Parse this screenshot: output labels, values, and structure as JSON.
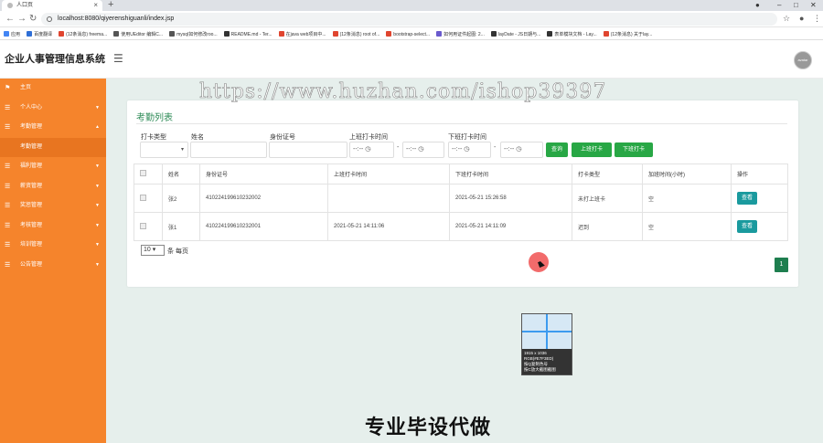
{
  "browser": {
    "tab_title": "人口页",
    "tab_close": "×",
    "new_tab": "+",
    "url": "localhost:8080/qiyerenshiguanli/index.jsp",
    "bookmarks": [
      "应用",
      "百度翻译",
      "(12条消息) freema...",
      "使用UEditor 编辑C...",
      "mysql如何修改roo...",
      "README.md - Ter...",
      "在java web项目中...",
      "(12条消息) root of...",
      "bootstrap-select...",
      "如何用证件起图: 2...",
      "layDate - JS日期与...",
      "表单模块文档 - Lay...",
      "(12条消息) 关于lay..."
    ]
  },
  "header": {
    "brand": "企业人事管理信息系统",
    "avatar_text": "avatar"
  },
  "sidebar": {
    "items": [
      {
        "label": "主页"
      },
      {
        "label": "个人中心"
      },
      {
        "label": "考勤管理"
      },
      {
        "label": "考勤管理"
      },
      {
        "label": "福利管理"
      },
      {
        "label": "薪资管理"
      },
      {
        "label": "奖惩管理"
      },
      {
        "label": "考核管理"
      },
      {
        "label": "培训管理"
      },
      {
        "label": "公告管理"
      }
    ]
  },
  "watermark": "https://www.huzhan.com/ishop39397",
  "main": {
    "title": "考勤列表",
    "filters": {
      "type_label": "打卡类型",
      "name_label": "姓名",
      "id_label": "身份证号",
      "on_label": "上班打卡时间",
      "off_label": "下班打卡时间",
      "time_placeholder": "--:-- ◷",
      "dash": "-"
    },
    "buttons": {
      "search": "查询",
      "clock_in": "上班打卡",
      "clock_out": "下班打卡"
    },
    "table": {
      "headers": [
        "姓名",
        "身份证号",
        "上班打卡时间",
        "下班打卡时间",
        "打卡类型",
        "加班时间(小时)",
        "操作"
      ],
      "rows": [
        {
          "name": "张2",
          "id": "410224199610232002",
          "on": "",
          "off": "2021-05-21 15:26:58",
          "type": "未打上班卡",
          "overtime": "空",
          "action": "查看"
        },
        {
          "name": "张1",
          "id": "410224199610232001",
          "on": "2021-05-21 14:11:06",
          "off": "2021-05-21 14:11:09",
          "type": "迟到",
          "overtime": "空",
          "action": "查看"
        }
      ]
    },
    "page_size": "10 ▾",
    "page_size_label": "条 每页",
    "current_page": "1"
  },
  "magnifier": {
    "line1": "1915 x 1036",
    "line2": "RGB(#E7F3ED)",
    "line3": "按Q复制色号",
    "line4": "按C放大截图截图"
  },
  "footer_text": "专业毕设代做",
  "colors": {
    "sidebar": "#f5842c",
    "accent_green": "#28a745",
    "view_button": "#1a9a9e",
    "content_bg": "#e6efec"
  }
}
